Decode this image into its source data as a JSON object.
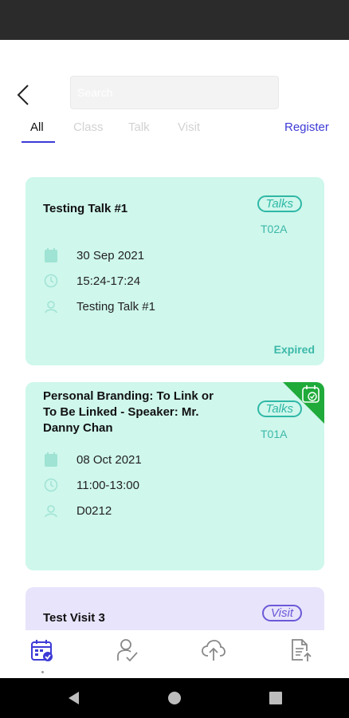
{
  "search": {
    "placeholder": "Search"
  },
  "tabs": {
    "all": "All",
    "class": "Class",
    "talk": "Talk",
    "visit": "Visit"
  },
  "register_label": "Register",
  "cards": [
    {
      "title": "Testing Talk #1",
      "tag": "Talks",
      "code": "T02A",
      "date": "30 Sep 2021",
      "time": "15:24-17:24",
      "location": "Testing Talk #1",
      "status": "Expired"
    },
    {
      "title": "Personal Branding: To Link or To Be Linked - Speaker: Mr. Danny Chan",
      "tag": "Talks",
      "code": "T01A",
      "date": "08 Oct 2021",
      "time": "11:00-13:00",
      "location": "D0212",
      "registered_icon": "calendar-check-icon"
    },
    {
      "title": "Test Visit 3",
      "tag": "Visit"
    }
  ],
  "bottom_nav": [
    "calendar-check-icon",
    "user-check-icon",
    "cloud-upload-icon",
    "document-upload-icon"
  ],
  "colors": {
    "accent": "#3d3bd6",
    "talk_card_bg": "#cff7ec",
    "visit_card_bg": "#e7e4fb",
    "talk_teal": "#2fb8a6",
    "visit_purple": "#6b59d8",
    "registered_badge": "#1faa3a"
  }
}
